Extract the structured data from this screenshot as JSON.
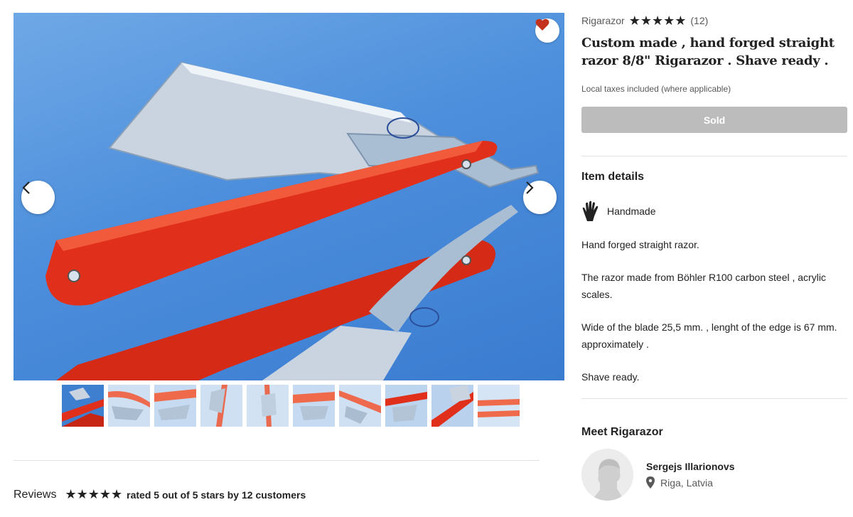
{
  "listing": {
    "shop_name": "Rigarazor",
    "rating_stars": "★★★★★",
    "review_count": "(12)",
    "title": "Custom made , hand forged straight razor 8/8\" Rigarazor . Shave ready .",
    "tax_note": "Local taxes included (where applicable)",
    "sold_label": "Sold"
  },
  "item_details": {
    "heading": "Item details",
    "handmade_label": "Handmade",
    "paragraphs": [
      "Hand forged straight razor.",
      "The razor made from Böhler R100 carbon steel , acrylic scales.",
      "Wide of the blade 25,5 mm. , lenght of the edge is 67 mm. approximately .",
      "Shave ready."
    ]
  },
  "meet_seller": {
    "heading": "Meet Rigarazor",
    "name": "Sergejs Illarionovs",
    "location": "Riga, Latvia"
  },
  "reviews": {
    "heading": "Reviews",
    "stars": "★★★★★",
    "summary": "rated 5 out of 5 stars by 12 customers"
  },
  "gallery": {
    "thumbnail_count": 10,
    "active_index": 0
  },
  "colors": {
    "scale_red": "#e0301c",
    "sky_blue": "#4d8fdc",
    "heart": "#c3321c",
    "sold_gray": "#bcbcbc"
  },
  "icons": [
    "heart-icon",
    "chevron-left-icon",
    "chevron-right-icon",
    "hand-icon",
    "location-pin-icon"
  ]
}
